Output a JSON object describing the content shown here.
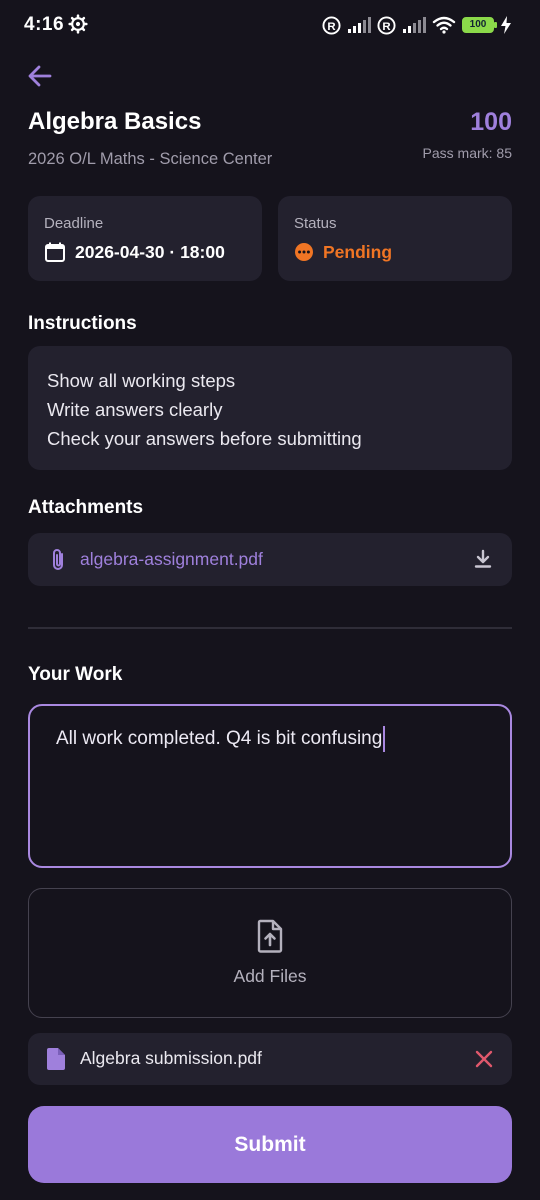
{
  "status_bar": {
    "time": "4:16",
    "battery": "100",
    "icons": [
      "gear-icon",
      "registered-icon",
      "signal-icon",
      "registered-icon",
      "signal-icon",
      "wifi-icon",
      "battery-icon",
      "charging-icon"
    ]
  },
  "header": {
    "back_icon": "arrow-left-icon",
    "title": "Algebra Basics",
    "subtitle": "2026 O/L Maths - Science Center",
    "points": "100",
    "pass_mark": "Pass mark: 85"
  },
  "deadline": {
    "label": "Deadline",
    "value": "2026-04-30 · 18:00",
    "icon": "calendar-icon"
  },
  "status": {
    "label": "Status",
    "value": "Pending",
    "icon": "pending-icon",
    "color": "#f07524"
  },
  "instructions": {
    "title": "Instructions",
    "lines": [
      "Show all working steps",
      "Write answers clearly",
      "Check your answers before submitting"
    ]
  },
  "attachments": {
    "title": "Attachments",
    "items": [
      {
        "name": "algebra-assignment.pdf",
        "icon": "paperclip-icon",
        "action_icon": "download-icon"
      }
    ]
  },
  "your_work": {
    "title": "Your Work",
    "text": "All work completed. Q4 is bit confusing",
    "add_files_label": "Add Files",
    "files": [
      {
        "name": "Algebra submission.pdf",
        "icon": "file-icon",
        "remove_icon": "close-icon"
      }
    ]
  },
  "submit_label": "Submit",
  "colors": {
    "background": "#15131c",
    "card": "#23212e",
    "accent": "#9f80dc",
    "pending": "#f07524",
    "remove": "#e0586c"
  }
}
